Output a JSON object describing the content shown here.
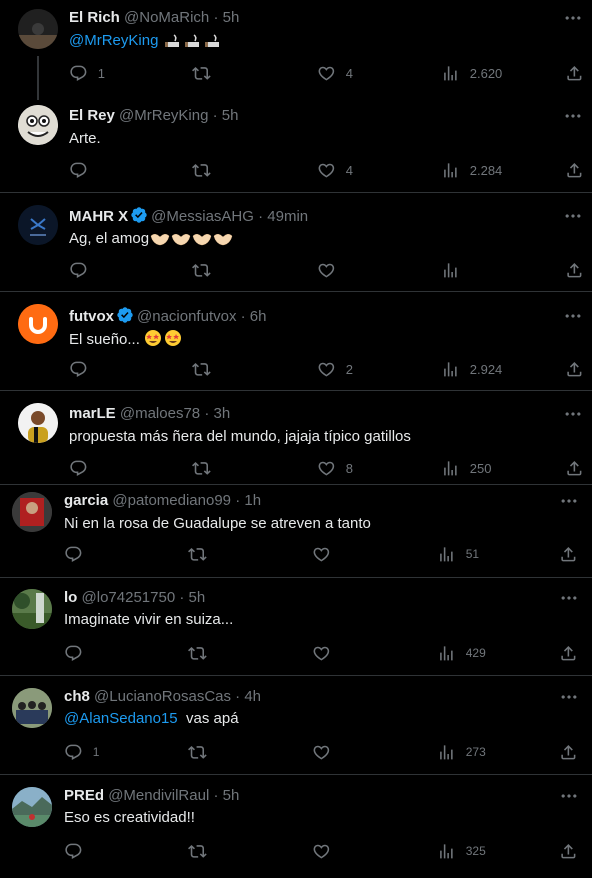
{
  "tweets": [
    {
      "name": "El Rich",
      "handle": "@NoMaRich",
      "time": "5h",
      "mention": "@MrReyKing",
      "text": "",
      "replies": "1",
      "likes": "4",
      "views": "2.620"
    },
    {
      "name": "El Rey",
      "handle": "@MrReyKing",
      "time": "5h",
      "text": "Arte.",
      "replies": "",
      "likes": "4",
      "views": "2.284"
    },
    {
      "name": "MAHR X",
      "handle": "@MessiasAHG",
      "time": "49min",
      "text": "Ag, el amog",
      "replies": "",
      "likes": "",
      "views": ""
    },
    {
      "name": "futvox",
      "handle": "@nacionfutvox",
      "time": "6h",
      "text": "El sueño...",
      "replies": "",
      "likes": "2",
      "views": "2.924"
    },
    {
      "name": "marLE",
      "handle": "@maloes78",
      "time": "3h",
      "text": "propuesta más ñera del mundo, jajaja típico gatillos",
      "replies": "",
      "likes": "8",
      "views": "250"
    },
    {
      "name": "garcia",
      "handle": "@patomediano99",
      "time": "1h",
      "text": "Ni en la rosa de Guadalupe se atreven a tanto",
      "replies": "",
      "likes": "",
      "views": "51"
    },
    {
      "name": "lo",
      "handle": "@lo74251750",
      "time": "5h",
      "text": "Imaginate vivir en suiza...",
      "replies": "",
      "likes": "",
      "views": "429"
    },
    {
      "name": "ch8",
      "handle": "@LucianoRosasCas",
      "time": "4h",
      "mention": "@AlanSedano15",
      "text": "vas apá",
      "replies": "1",
      "likes": "",
      "views": "273"
    },
    {
      "name": "PREd",
      "handle": "@MendivilRaul",
      "time": "5h",
      "text": "Eso es creatividad!!",
      "replies": "",
      "likes": "",
      "views": "325"
    }
  ],
  "separator": "·",
  "icons": {
    "reply": "reply-icon",
    "retweet": "retweet-icon",
    "like": "heart-icon",
    "views": "views-icon",
    "share": "share-icon",
    "more": "more-icon",
    "verified": "verified-badge-icon"
  },
  "colors": {
    "background": "#000000",
    "text": "#e7e9ea",
    "muted": "#71767b",
    "link": "#1d9bf0",
    "divider": "#2f3336",
    "verified": "#1d9bf0"
  }
}
